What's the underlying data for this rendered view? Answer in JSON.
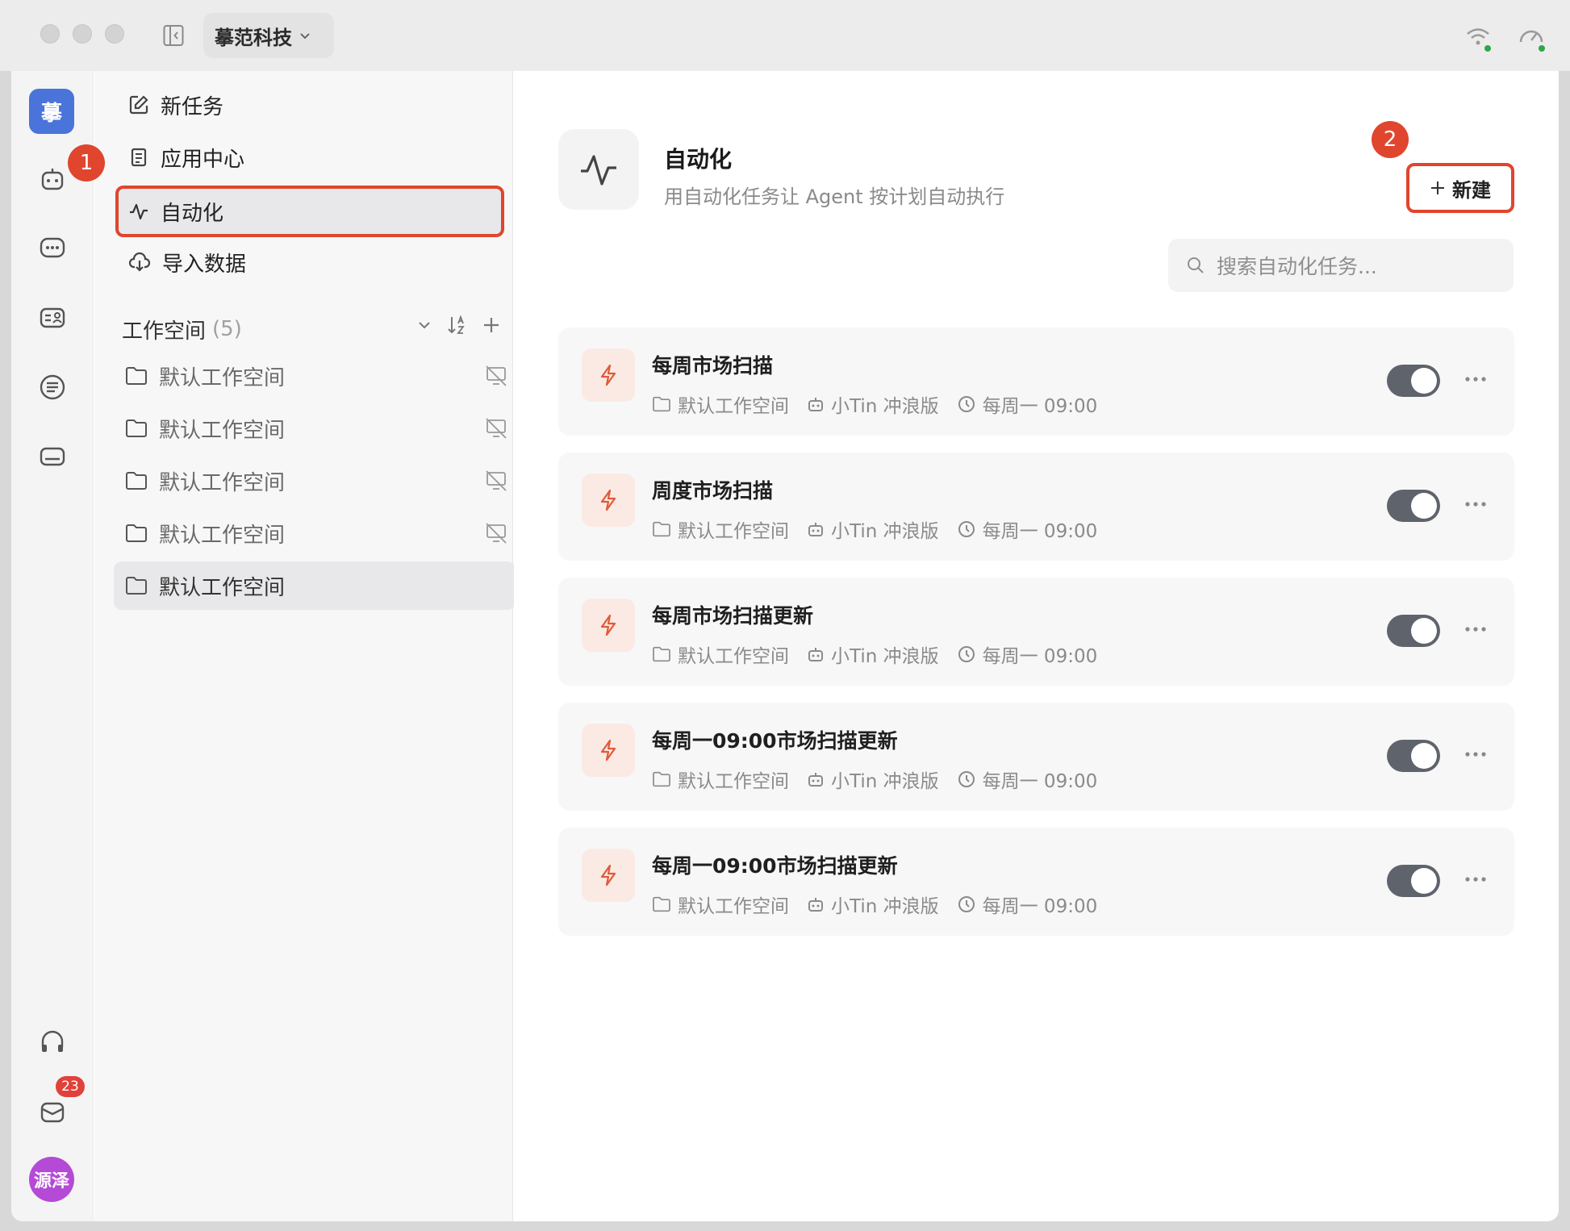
{
  "titlebar": {
    "org_name": "摹范科技"
  },
  "rail": {
    "logo_text": "摹",
    "mail_badge": "23",
    "avatar_text": "源泽"
  },
  "nav": {
    "items": [
      {
        "label": "新任务",
        "icon": "edit-icon"
      },
      {
        "label": "应用中心",
        "icon": "document-icon"
      },
      {
        "label": "自动化",
        "icon": "pulse-icon",
        "active": true
      },
      {
        "label": "导入数据",
        "icon": "cloud-download-icon"
      }
    ],
    "workspace_title": "工作空间",
    "workspace_count": "(5)",
    "workspaces": [
      {
        "label": "默认工作空间"
      },
      {
        "label": "默认工作空间"
      },
      {
        "label": "默认工作空间"
      },
      {
        "label": "默认工作空间"
      },
      {
        "label": "默认工作空间",
        "selected": true
      }
    ]
  },
  "annotations": {
    "first": "1",
    "second": "2"
  },
  "main": {
    "title": "自动化",
    "subtitle": "用自动化任务让 Agent 按计划自动执行",
    "new_button": "新建",
    "search_placeholder": "搜索自动化任务..."
  },
  "tasks": [
    {
      "title": "每周市场扫描",
      "workspace": "默认工作空间",
      "agent": "小Tin 冲浪版",
      "schedule": "每周一 09:00",
      "enabled": true
    },
    {
      "title": "周度市场扫描",
      "workspace": "默认工作空间",
      "agent": "小Tin 冲浪版",
      "schedule": "每周一 09:00",
      "enabled": true
    },
    {
      "title": "每周市场扫描更新",
      "workspace": "默认工作空间",
      "agent": "小Tin 冲浪版",
      "schedule": "每周一 09:00",
      "enabled": true
    },
    {
      "title": "每周一09:00市场扫描更新",
      "workspace": "默认工作空间",
      "agent": "小Tin 冲浪版",
      "schedule": "每周一 09:00",
      "enabled": true
    },
    {
      "title": "每周一09:00市场扫描更新",
      "workspace": "默认工作空间",
      "agent": "小Tin 冲浪版",
      "schedule": "每周一 09:00",
      "enabled": true
    }
  ],
  "colors": {
    "accent_red": "#e0452e",
    "toggle_on": "#5f636b",
    "brand_blue": "#4a74d9",
    "avatar_purple": "#b44ad6"
  }
}
